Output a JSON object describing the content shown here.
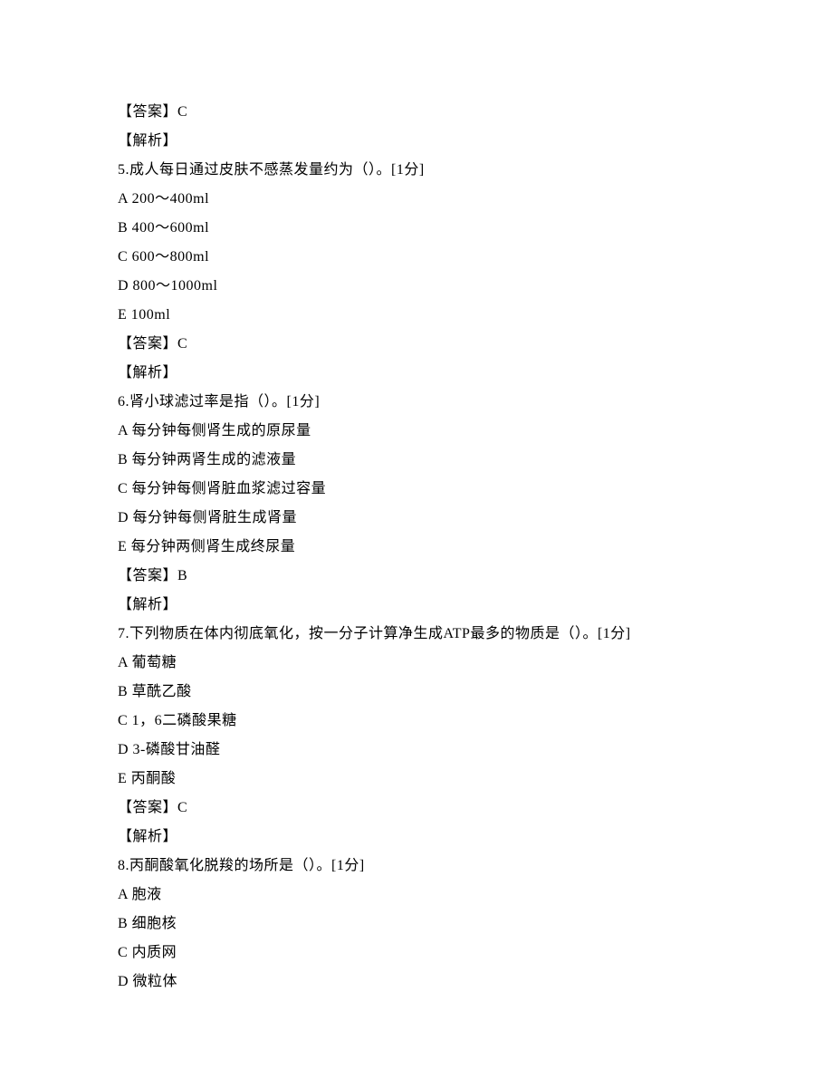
{
  "lines": [
    "【答案】C",
    "【解析】",
    "5.成人每日通过皮肤不感蒸发量约为（）。[1分]",
    "A 200～400ml",
    "B 400～600ml",
    "C 600～800ml",
    "D 800～1000ml",
    "E 100ml",
    "【答案】C",
    "【解析】",
    "6.肾小球滤过率是指（）。[1分]",
    "A 每分钟每侧肾生成的原尿量",
    "B 每分钟两肾生成的滤液量",
    "C 每分钟每侧肾脏血浆滤过容量",
    "D 每分钟每侧肾脏生成肾量",
    "E 每分钟两侧肾生成终尿量",
    "【答案】B",
    "【解析】",
    "7.下列物质在体内彻底氧化，按一分子计算净生成ATP最多的物质是（）。[1分]",
    "A 葡萄糖",
    "B 草酰乙酸",
    "C 1，6二磷酸果糖",
    "D 3-磷酸甘油醛",
    "E 丙酮酸",
    "【答案】C",
    "【解析】",
    "8.丙酮酸氧化脱羧的场所是（）。[1分]",
    "A 胞液",
    "B 细胞核",
    "C 内质网",
    "D 微粒体"
  ]
}
